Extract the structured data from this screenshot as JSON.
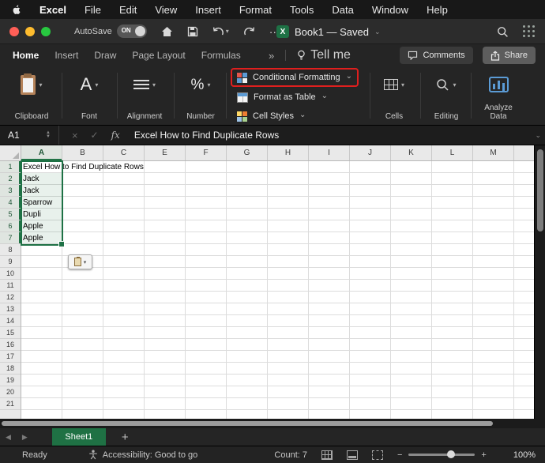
{
  "colors": {
    "accent_green": "#217346",
    "highlight_red": "#df1f1e",
    "sheet_tab_green": "#1f7144"
  },
  "menu_bar": {
    "items": [
      "Excel",
      "File",
      "Edit",
      "View",
      "Insert",
      "Format",
      "Tools",
      "Data",
      "Window",
      "Help"
    ]
  },
  "title_bar": {
    "autosave_label": "AutoSave",
    "autosave_state": "ON",
    "doc_icon_letter": "X",
    "doc_title": "Book1 — Saved",
    "ellipsis_label": "···"
  },
  "ribbon_tabs": {
    "items": [
      {
        "label": "Home",
        "selected": true
      },
      {
        "label": "Insert"
      },
      {
        "label": "Draw"
      },
      {
        "label": "Page Layout"
      },
      {
        "label": "Formulas"
      }
    ],
    "overflow_label": "»",
    "tell_me_label": "Tell me",
    "comments_label": "Comments",
    "share_label": "Share"
  },
  "ribbon": {
    "groups": {
      "clipboard": "Clipboard",
      "font": "Font",
      "font_glyph": "A",
      "alignment": "Alignment",
      "number": "Number",
      "number_glyph": "%",
      "cells": "Cells",
      "editing": "Editing",
      "analyze": "Analyze Data"
    },
    "style_buttons": [
      {
        "label": "Conditional Formatting",
        "highlighted": true
      },
      {
        "label": "Format as Table"
      },
      {
        "label": "Cell Styles"
      }
    ]
  },
  "formula_bar": {
    "name_box": "A1",
    "fx_label": "fx",
    "content": "Excel How to Find Duplicate Rows"
  },
  "grid": {
    "column_headers": [
      "A",
      "B",
      "C",
      "E",
      "F",
      "G",
      "H",
      "I",
      "J",
      "K",
      "L",
      "M"
    ],
    "row_count": 21,
    "selected_column": "A",
    "selected_rows": 7,
    "selected_range": "A1:A7",
    "cells": [
      {
        "row": 1,
        "col": "A",
        "text": "Excel How to Find Duplicate Rows"
      },
      {
        "row": 2,
        "col": "A",
        "text": "Jack"
      },
      {
        "row": 3,
        "col": "A",
        "text": "Jack"
      },
      {
        "row": 4,
        "col": "A",
        "text": "Sparrow"
      },
      {
        "row": 5,
        "col": "A",
        "text": "Dupli"
      },
      {
        "row": 6,
        "col": "A",
        "text": "Apple"
      },
      {
        "row": 7,
        "col": "A",
        "text": "Apple"
      }
    ]
  },
  "sheet_bar": {
    "tabs": [
      {
        "label": "Sheet1",
        "selected": true
      }
    ],
    "add_label": "+"
  },
  "status_bar": {
    "ready_label": "Ready",
    "accessibility_label": "Accessibility: Good to go",
    "count_label": "Count: 7",
    "zoom_minus": "−",
    "zoom_plus": "+",
    "zoom_level": "100%"
  }
}
